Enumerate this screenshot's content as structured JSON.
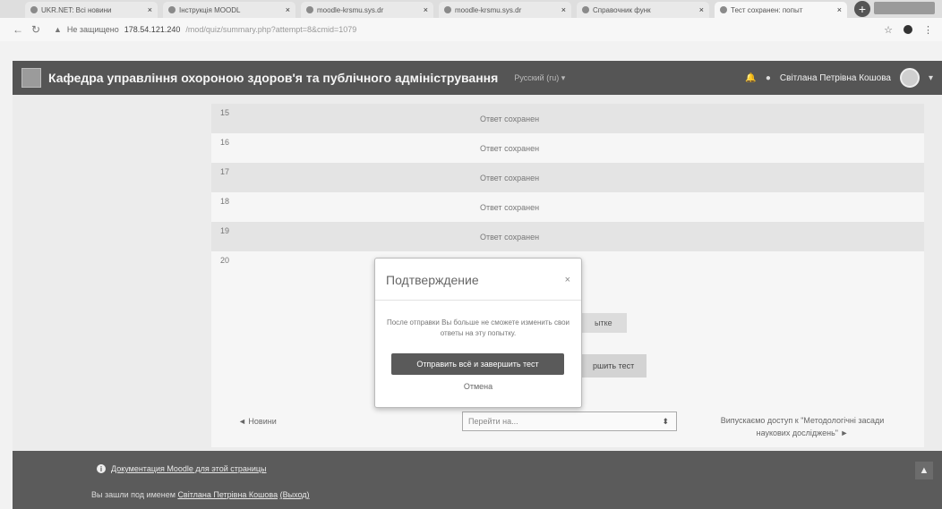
{
  "browser": {
    "tabs": [
      {
        "title": "UKR.NET: Всі новини"
      },
      {
        "title": "Інструкція MOODL"
      },
      {
        "title": "moodle-krsmu.sys.dr"
      },
      {
        "title": "moodle-krsmu.sys.dr"
      },
      {
        "title": "Справочник функ"
      },
      {
        "title": "Тест сохранен: попыт"
      }
    ],
    "new_tab": "+",
    "url_warning": "Не защищено",
    "url_host": "178.54.121.240",
    "url_path": "/mod/quiz/summary.php?attempt=8&cmid=1079"
  },
  "navbar": {
    "site_title": "Кафедра управління охороною здоров'я та публічного адміністрування",
    "language": "Русский (ru) ▾",
    "user_name": "Світлана Петрівна Кошова"
  },
  "questions": [
    {
      "num": "15",
      "status": "Ответ сохранен"
    },
    {
      "num": "16",
      "status": "Ответ сохранен"
    },
    {
      "num": "17",
      "status": "Ответ сохранен"
    },
    {
      "num": "18",
      "status": "Ответ сохранен"
    },
    {
      "num": "19",
      "status": "Ответ сохранен"
    },
    {
      "num": "20",
      "status": ""
    }
  ],
  "actions": {
    "return_partial": "ытке",
    "finish_partial": "ршить тест"
  },
  "activity_nav": {
    "prev": "◄ Новини",
    "jump_placeholder": "Перейти на...",
    "next": "Випускаємо доступ к \"Методологічні засади наукових досліджень\" ►"
  },
  "footer": {
    "doc_link": "Документация Moodle для этой страницы",
    "login_prefix": "Вы зашли под именем",
    "login_user": "Світлана Петрівна Кошова",
    "logout": "(Выход)",
    "to_top": "▲"
  },
  "modal": {
    "title": "Подтверждение",
    "close": "×",
    "body": "После отправки Вы больше не сможете изменить свои ответы на эту попытку.",
    "submit": "Отправить всё и завершить тест",
    "cancel": "Отмена"
  }
}
